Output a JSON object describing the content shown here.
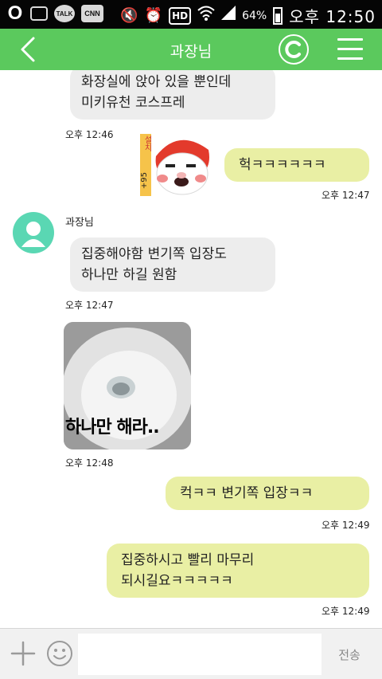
{
  "status_bar": {
    "left_icons": [
      "O",
      "image-icon",
      "TALK",
      "CNN"
    ],
    "battery": "64%",
    "time": "오후 12:50",
    "hd": "HD"
  },
  "header": {
    "title": "과장님",
    "icons": [
      "back-arrow-icon",
      "c-logo-icon",
      "menu-icon"
    ]
  },
  "chat": {
    "messages": [
      {
        "side": "in",
        "text": "화장실에 앉아 있을 뿐인데\n미키유천 코스프레",
        "time": "오후 12:46"
      },
      {
        "side": "sticker",
        "sticker_label": "설치",
        "sticker_badge": "+95"
      },
      {
        "side": "out",
        "text": "헉ㅋㅋㅋㅋㅋㅋ",
        "time": "오후 12:47"
      },
      {
        "side": "in",
        "sender": "과장님",
        "text": "집중해야함 변기쪽 입장도\n하나만 하길 원함",
        "time": "오후 12:47"
      },
      {
        "side": "photo",
        "caption": "하나만 해라..",
        "time": "오후 12:48"
      },
      {
        "side": "out",
        "text": "컥ㅋㅋ 변기쪽 입장ㅋㅋ",
        "time": "오후 12:49"
      },
      {
        "side": "out",
        "text": "집중하시고 빨리 마무리\n되시길요ㅋㅋㅋㅋㅋ",
        "time": "오후 12:49"
      }
    ]
  },
  "input_bar": {
    "placeholder": "",
    "send_label": "전송"
  },
  "colors": {
    "header": "#5bc95d",
    "bubble_in": "#ededed",
    "bubble_out": "#e9efa4",
    "avatar": "#5ad7b3"
  }
}
